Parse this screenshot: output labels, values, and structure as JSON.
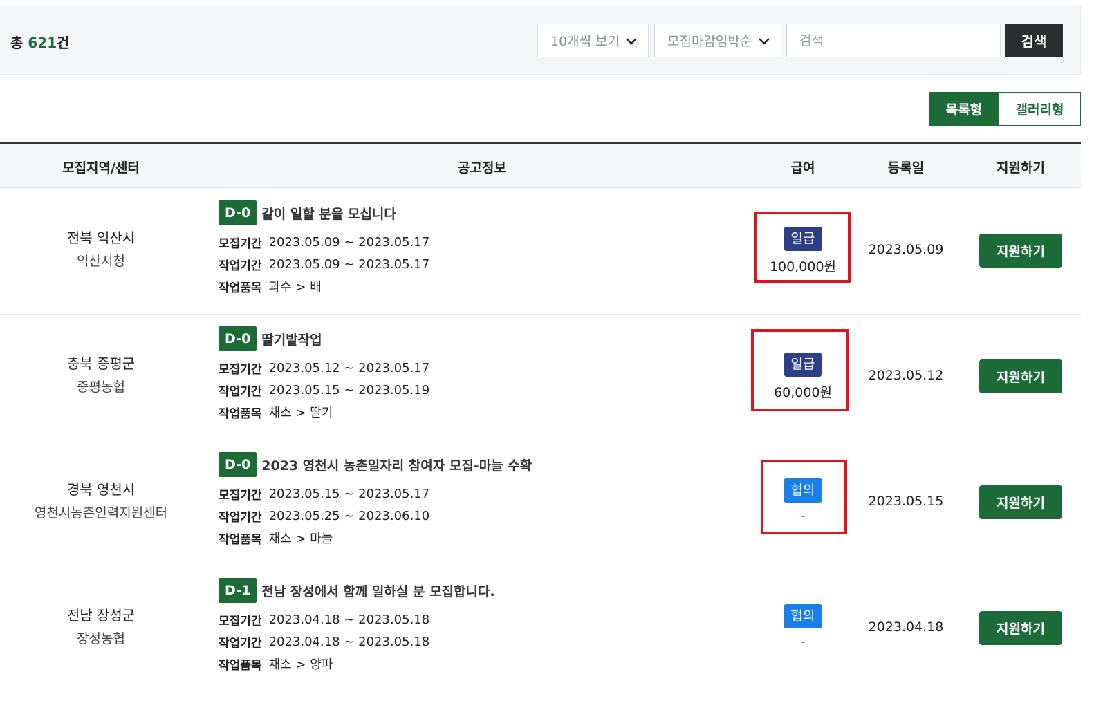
{
  "header": {
    "total_prefix": "총 ",
    "total_count": "621",
    "total_suffix": "건",
    "per_page_select": "10개씩 보기",
    "sort_select": "모집마감임박순",
    "search_placeholder": "검색",
    "search_button": "검색"
  },
  "view_toggle": {
    "list_label": "목록형",
    "gallery_label": "갤러리형",
    "active": "목록형"
  },
  "table": {
    "columns": [
      "모집지역/센터",
      "공고정보",
      "급여",
      "등록일",
      "지원하기"
    ],
    "labels": {
      "recruit_period": "모집기간",
      "work_period": "작업기간",
      "work_item": "작업품목"
    },
    "rows": [
      {
        "region": "전북 익산시",
        "center": "익산시청",
        "dday": "D-0",
        "title": "같이 일할 분을 모십니다",
        "recruit_period": "2023.05.09 ~ 2023.05.17",
        "work_period": "2023.05.09 ~ 2023.05.17",
        "work_item": "과수 > 배",
        "pay_type": "일급",
        "pay_amount": "100,000원",
        "reg_date": "2023.05.09",
        "apply_label": "지원하기"
      },
      {
        "region": "충북 증평군",
        "center": "증평농협",
        "dday": "D-0",
        "title": "딸기밭작업",
        "recruit_period": "2023.05.12 ~ 2023.05.17",
        "work_period": "2023.05.15 ~ 2023.05.19",
        "work_item": "채소 > 딸기",
        "pay_type": "일급",
        "pay_amount": "60,000원",
        "reg_date": "2023.05.12",
        "apply_label": "지원하기"
      },
      {
        "region": "경북 영천시",
        "center": "영천시농촌인력지원센터",
        "dday": "D-0",
        "title": "2023 영천시 농촌일자리 참여자 모집-마늘 수확",
        "recruit_period": "2023.05.15 ~ 2023.05.17",
        "work_period": "2023.05.25 ~ 2023.06.10",
        "work_item": "채소 > 마늘",
        "pay_type": "협의",
        "pay_amount": "-",
        "reg_date": "2023.05.15",
        "apply_label": "지원하기"
      },
      {
        "region": "전남 장성군",
        "center": "장성농협",
        "dday": "D-1",
        "title": "전남 장성에서 함께 일하실 분 모집합니다.",
        "recruit_period": "2023.04.18 ~ 2023.05.18",
        "work_period": "2023.04.18 ~ 2023.05.18",
        "work_item": "채소 > 양파",
        "pay_type": "협의",
        "pay_amount": "-",
        "reg_date": "2023.04.18",
        "apply_label": "지원하기"
      }
    ]
  },
  "colors": {
    "brand_green": "#1e6b3a",
    "daily_badge": "#2e3f8a",
    "negotiable_badge": "#1a7fe6",
    "highlight_red": "#e0141e",
    "dark_button": "#2b2d2f"
  }
}
